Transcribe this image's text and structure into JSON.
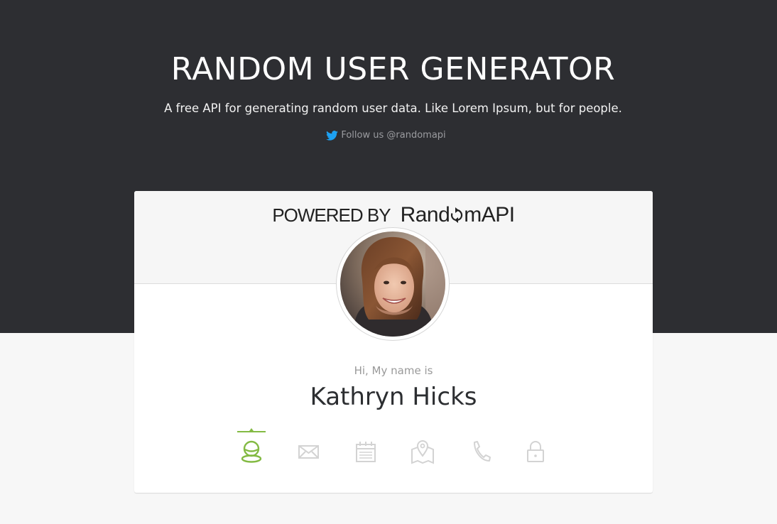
{
  "header": {
    "title": "RANDOM USER GENERATOR",
    "subtitle": "A free API for generating random user data. Like Lorem Ipsum, but for people.",
    "follow_label": "Follow us @randomapi"
  },
  "card": {
    "powered_by": "POWERED BY",
    "brand_prefix": "Rand",
    "brand_suffix": "mAPI",
    "greeting": "Hi, My name is",
    "name": "Kathryn Hicks",
    "tabs": [
      {
        "icon": "user-icon",
        "active": true
      },
      {
        "icon": "envelope-icon",
        "active": false
      },
      {
        "icon": "calendar-icon",
        "active": false
      },
      {
        "icon": "map-icon",
        "active": false
      },
      {
        "icon": "phone-icon",
        "active": false
      },
      {
        "icon": "lock-icon",
        "active": false
      }
    ]
  },
  "colors": {
    "hero_bg": "#2d2e32",
    "accent": "#83ba43",
    "twitter": "#1da1f2",
    "icon_inactive": "#d3d3d3"
  }
}
